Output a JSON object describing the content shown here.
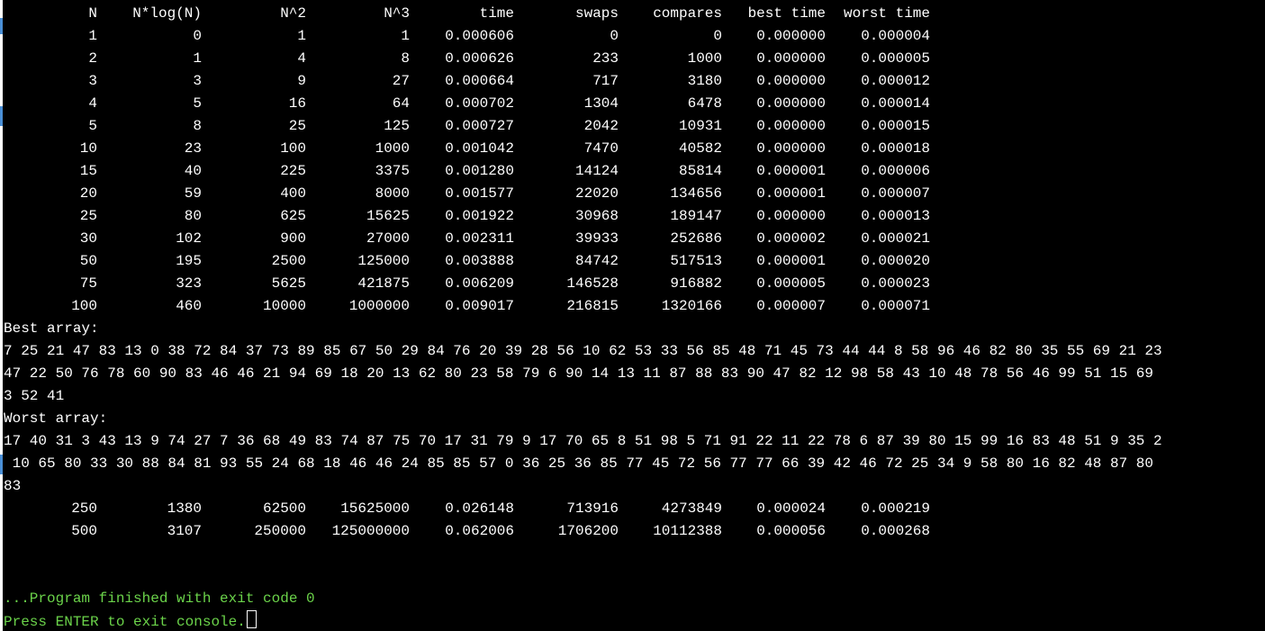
{
  "colors": {
    "background": "#000000",
    "text": "#ffffff",
    "status_text": "#6bd34a"
  },
  "table": {
    "headers": [
      "N",
      "N*log(N)",
      "N^2",
      "N^3",
      "time",
      "swaps",
      "compares",
      "best time",
      "worst time"
    ],
    "rows_part1": [
      [
        "1",
        "0",
        "1",
        "1",
        "0.000606",
        "0",
        "0",
        "0.000000",
        "0.000004"
      ],
      [
        "2",
        "1",
        "4",
        "8",
        "0.000626",
        "233",
        "1000",
        "0.000000",
        "0.000005"
      ],
      [
        "3",
        "3",
        "9",
        "27",
        "0.000664",
        "717",
        "3180",
        "0.000000",
        "0.000012"
      ],
      [
        "4",
        "5",
        "16",
        "64",
        "0.000702",
        "1304",
        "6478",
        "0.000000",
        "0.000014"
      ],
      [
        "5",
        "8",
        "25",
        "125",
        "0.000727",
        "2042",
        "10931",
        "0.000000",
        "0.000015"
      ],
      [
        "10",
        "23",
        "100",
        "1000",
        "0.001042",
        "7470",
        "40582",
        "0.000000",
        "0.000018"
      ],
      [
        "15",
        "40",
        "225",
        "3375",
        "0.001280",
        "14124",
        "85814",
        "0.000001",
        "0.000006"
      ],
      [
        "20",
        "59",
        "400",
        "8000",
        "0.001577",
        "22020",
        "134656",
        "0.000001",
        "0.000007"
      ],
      [
        "25",
        "80",
        "625",
        "15625",
        "0.001922",
        "30968",
        "189147",
        "0.000000",
        "0.000013"
      ],
      [
        "30",
        "102",
        "900",
        "27000",
        "0.002311",
        "39933",
        "252686",
        "0.000002",
        "0.000021"
      ],
      [
        "50",
        "195",
        "2500",
        "125000",
        "0.003888",
        "84742",
        "517513",
        "0.000001",
        "0.000020"
      ],
      [
        "75",
        "323",
        "5625",
        "421875",
        "0.006209",
        "146528",
        "916882",
        "0.000005",
        "0.000023"
      ],
      [
        "100",
        "460",
        "10000",
        "1000000",
        "0.009017",
        "216815",
        "1320166",
        "0.000007",
        "0.000071"
      ]
    ],
    "rows_part2": [
      [
        "250",
        "1380",
        "62500",
        "15625000",
        "0.026148",
        "713916",
        "4273849",
        "0.000024",
        "0.000219"
      ],
      [
        "500",
        "3107",
        "250000",
        "125000000",
        "0.062006",
        "1706200",
        "10112388",
        "0.000056",
        "0.000268"
      ]
    ]
  },
  "best_array": {
    "label": "Best array:",
    "lines": [
      "7 25 21 47 83 13 0 38 72 84 37 73 89 85 67 50 29 84 76 20 39 28 56 10 62 53 33 56 85 48 71 45 73 44 44 8 58 96 46 82 80 35 55 69 21 23",
      "47 22 50 76 78 60 90 83 46 46 21 94 69 18 20 13 62 80 23 58 79 6 90 14 13 11 87 88 83 90 47 82 12 98 58 43 10 48 78 56 46 99 51 15 69",
      "3 52 41"
    ]
  },
  "worst_array": {
    "label": "Worst array:",
    "lines": [
      "17 40 31 3 43 13 9 74 27 7 36 68 49 83 74 87 75 70 17 31 79 9 17 70 65 8 51 98 5 71 91 22 11 22 78 6 87 39 80 15 99 16 83 48 51 9 35 2",
      " 10 65 80 33 30 88 84 81 93 55 24 68 18 46 46 24 85 85 57 0 36 25 36 85 77 45 72 56 77 77 66 39 42 46 72 25 34 9 58 80 16 82 48 87 80",
      "83"
    ]
  },
  "status": {
    "finished": "...Program finished with exit code 0",
    "prompt": "Press ENTER to exit console."
  }
}
